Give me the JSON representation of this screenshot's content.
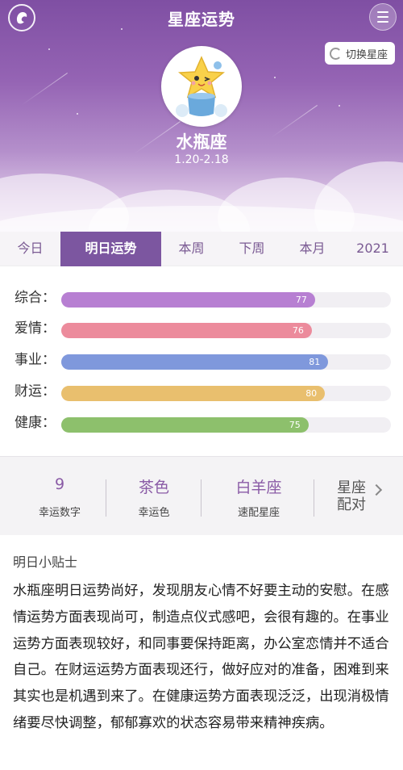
{
  "header": {
    "title": "星座运势",
    "switch_label": "切换星座",
    "sign_name": "水瓶座",
    "sign_dates": "1.20-2.18"
  },
  "tabs": [
    {
      "label": "今日",
      "active": false
    },
    {
      "label": "明日运势",
      "active": true
    },
    {
      "label": "本周",
      "active": false
    },
    {
      "label": "下周",
      "active": false
    },
    {
      "label": "本月",
      "active": false
    },
    {
      "label": "2021",
      "active": false
    }
  ],
  "fortune_bars": [
    {
      "label": "综合：",
      "value": 77,
      "value_text": "77",
      "color": "#b77fd2"
    },
    {
      "label": "爱情：",
      "value": 76,
      "value_text": "76",
      "color": "#ec8b9c"
    },
    {
      "label": "事业：",
      "value": 81,
      "value_text": "81",
      "color": "#7f98dc"
    },
    {
      "label": "财运：",
      "value": 80,
      "value_text": "80",
      "color": "#e9bf6e"
    },
    {
      "label": "健康：",
      "value": 75,
      "value_text": "75",
      "color": "#8dc06c"
    }
  ],
  "lucky": {
    "number": {
      "value": "9",
      "label": "幸运数字"
    },
    "color": {
      "value": "茶色",
      "label": "幸运色"
    },
    "match": {
      "value": "白羊座",
      "label": "速配星座"
    },
    "pair_link": {
      "line1": "星座",
      "line2": "配对"
    }
  },
  "tips": {
    "title": "明日小贴士",
    "body": "水瓶座明日运势尚好，发现朋友心情不好要主动的安慰。在感情运势方面表现尚可，制造点仪式感吧，会很有趣的。在事业运势方面表现较好，和同事要保持距离，办公室恋情并不适合自己。在财运运势方面表现还行，做好应对的准备，困难到来其实也是机遇到来了。在健康运势方面表现泛泛，出现消极情绪要尽快调整，郁郁寡欢的状态容易带来精神疾病。"
  },
  "theme": {
    "accent": "#7c56a0"
  }
}
